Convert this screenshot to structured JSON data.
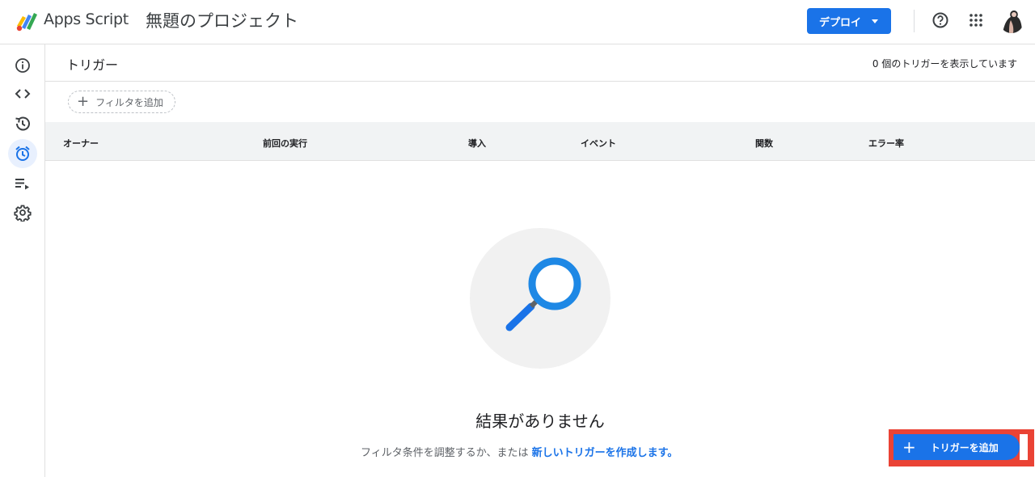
{
  "header": {
    "brand": "Apps Script",
    "project_title": "無題のプロジェクト",
    "deploy_label": "デプロイ"
  },
  "rail": {
    "items": [
      "overview",
      "editor",
      "executions",
      "triggers",
      "executions-log",
      "settings"
    ]
  },
  "page": {
    "title": "トリガー",
    "count_text": "0 個のトリガーを表示しています",
    "filter_label": "フィルタを追加"
  },
  "table": {
    "headers": [
      "オーナー",
      "前回の実行",
      "導入",
      "イベント",
      "関数",
      "エラー率"
    ]
  },
  "empty": {
    "title": "結果がありません",
    "sub_text": "フィルタ条件を調整するか、または",
    "link_text": "新しいトリガーを作成します。"
  },
  "fab": {
    "label": "トリガーを追加"
  },
  "colors": {
    "accent": "#1a73e8",
    "highlight": "#ea4335",
    "active_rail": "#e8f0fe"
  }
}
